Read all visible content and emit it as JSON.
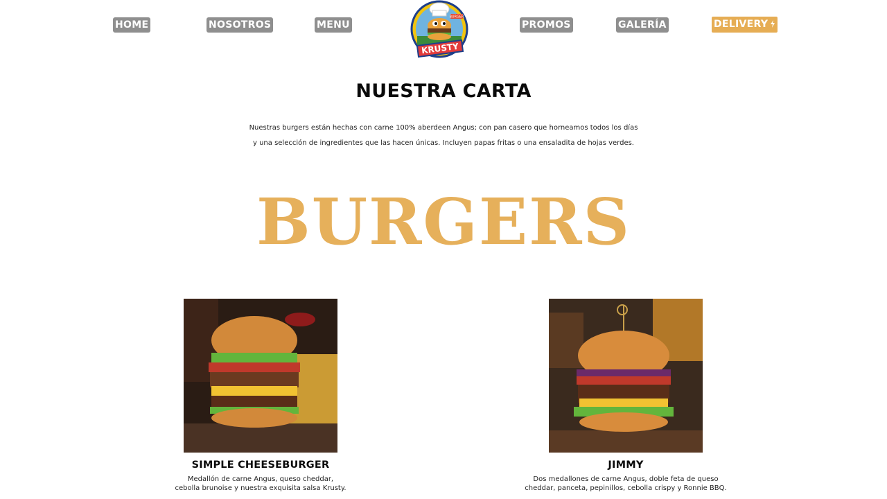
{
  "nav": {
    "items": [
      {
        "label": "HOME"
      },
      {
        "label": "NOSOTROS"
      },
      {
        "label": "MENU"
      },
      {
        "label": "PROMOS"
      },
      {
        "label": "GALERÍA"
      }
    ],
    "delivery_label": "DELIVERY",
    "delivery_icon": "lightning-icon",
    "logo_text": "KRUSTY",
    "logo_badge": "BURGER"
  },
  "intro": {
    "title": "NUESTRA CARTA",
    "description_line1": "Nuestras burgers están hechas con carne 100% aberdeen Angus; con pan casero que horneamos todos los días",
    "description_line2": "y una selección de ingredientes que las hacen únicas. Incluyen papas fritas o una ensaladita de hojas verdes."
  },
  "section": {
    "title": "BURGERS"
  },
  "products": [
    {
      "name": "SIMPLE CHEESEBURGER",
      "desc_line1": "Medallón de carne Angus, queso cheddar,",
      "desc_line2": "cebolla brunoise y nuestra exquisita salsa Krusty."
    },
    {
      "name": "JIMMY",
      "desc_line1": "Dos medallones de carne Angus, doble feta de queso",
      "desc_line2": "cheddar, panceta, pepinillos, cebolla crispy y Ronnie BBQ."
    }
  ],
  "colors": {
    "nav_button": "#8f8f8f",
    "delivery_button": "#e6ad54",
    "section_title": "#e6b05b"
  }
}
